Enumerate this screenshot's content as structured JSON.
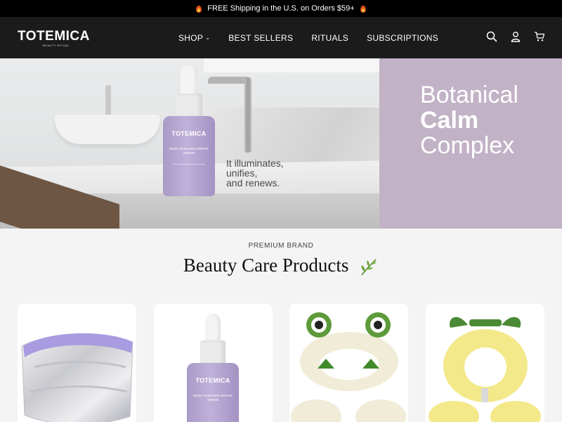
{
  "announcement": {
    "text": "FREE Shipping in the U.S. on Orders $59+"
  },
  "header": {
    "logo": "TOTEMICA",
    "logo_sub": "BEAUTY RITUAL",
    "nav": [
      {
        "label": "SHOP",
        "has_dropdown": true
      },
      {
        "label": "BEST SELLERS"
      },
      {
        "label": "RITUALS"
      },
      {
        "label": "SUBSCRIPTIONS"
      }
    ],
    "icons": [
      "search-icon",
      "account-icon",
      "cart-icon"
    ]
  },
  "hero": {
    "bottle_brand": "TOTEMICA",
    "bottle_label": "MUSU RADIANCE REPAIR SERUM",
    "tagline_lines": [
      "It illuminates,",
      "unifies,",
      "and renews."
    ],
    "headline_lines": [
      "Botanical",
      "Calm",
      "Complex"
    ],
    "panel_color": "#c2b2c6"
  },
  "section": {
    "eyebrow": "PREMIUM BRAND",
    "title": "Beauty Care Products"
  },
  "products": [
    {
      "image": "silver-puffer-cosmetic-bag"
    },
    {
      "image": "radiance-repair-serum-bottle",
      "brand": "TOTEMICA",
      "label": "MUSU RADIANCE REPAIR SERUM"
    },
    {
      "image": "frog-spa-headband-wristbands"
    },
    {
      "image": "pineapple-spa-headband-wristbands"
    }
  ],
  "colors": {
    "topbar": "#000000",
    "header": "#1b1b1b",
    "hero_panel": "#c2b2c6",
    "page_bg": "#f4f4f4"
  }
}
